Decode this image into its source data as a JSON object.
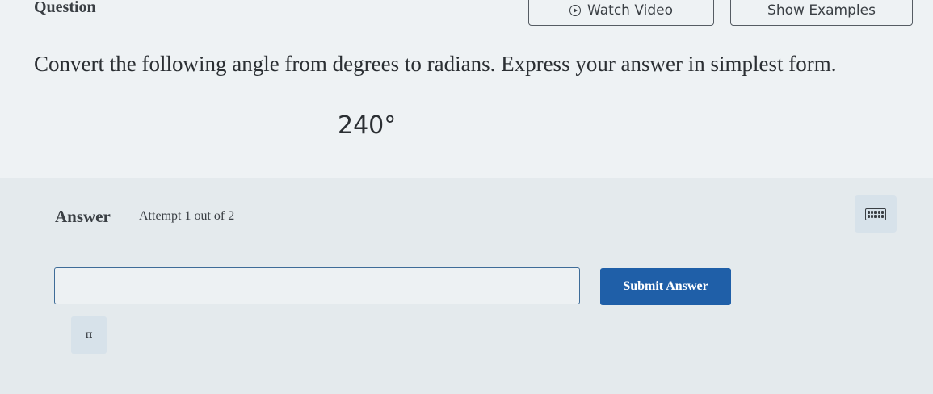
{
  "header": {
    "question_label": "Question",
    "watch_video_label": "Watch Video",
    "show_examples_label": "Show Examples"
  },
  "question": {
    "prompt": "Convert the following angle from degrees to radians. Express your answer in simplest form.",
    "angle": "240°"
  },
  "answer": {
    "label": "Answer",
    "attempt_text": "Attempt 1 out of 2",
    "input_value": "",
    "input_placeholder": "",
    "submit_label": "Submit Answer",
    "pi_symbol": "π",
    "keyboard_icon": "keyboard-icon"
  },
  "colors": {
    "submit_bg": "#1f5fa8",
    "input_border": "#3e6c98",
    "tool_bg": "#d7e2ea"
  }
}
